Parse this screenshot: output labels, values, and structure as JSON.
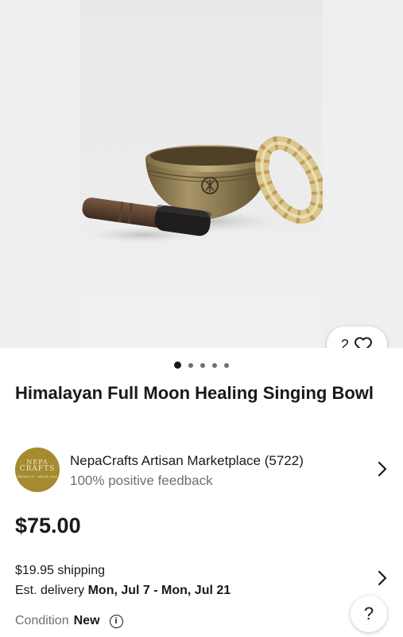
{
  "gallery": {
    "watch_count": "2",
    "heart_icon": "heart-outline-icon",
    "photo_count": 5,
    "active_photo_index": 0
  },
  "listing": {
    "title": "Himalayan Full Moon Healing Singing Bowl",
    "price": "$75.00"
  },
  "seller": {
    "logo_text_1": "NEPA",
    "logo_text_2": "CRAFTS",
    "logo_text_3": "PRODUCT · SINCE 2005",
    "name": "NepaCrafts Artisan Marketplace (5722)",
    "feedback": "100% positive feedback"
  },
  "shipping": {
    "cost": "$19.95 shipping",
    "delivery_prefix": "Est. delivery ",
    "delivery_range": "Mon, Jul 7 - Mon, Jul 21"
  },
  "condition": {
    "label": "Condition",
    "value": "New"
  },
  "help": {
    "label": "?"
  },
  "colors": {
    "text": "#191919",
    "secondary": "#707070",
    "logo_gold": "#a58a2f"
  }
}
